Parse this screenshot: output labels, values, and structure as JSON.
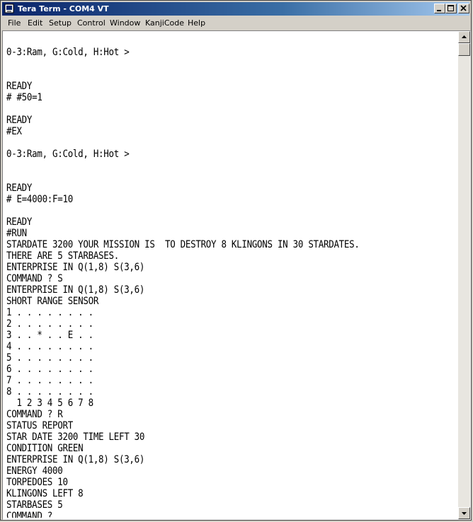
{
  "window": {
    "title": "Tera Term - COM4 VT"
  },
  "menu": [
    "File",
    "Edit",
    "Setup",
    "Control",
    "Window",
    "KanjiCode",
    "Help"
  ],
  "terminal": {
    "lines": [
      "",
      "0-3:Ram, G:Cold, H:Hot >",
      "",
      "",
      "READY",
      "# #50=1",
      "",
      "READY",
      "#EX",
      "",
      "0-3:Ram, G:Cold, H:Hot >",
      "",
      "",
      "READY",
      "# E=4000:F=10",
      "",
      "READY",
      "#RUN",
      "STARDATE 3200 YOUR MISSION IS  TO DESTROY 8 KLINGONS IN 30 STARDATES.",
      "THERE ARE 5 STARBASES.",
      "ENTERPRISE IN Q(1,8) S(3,6)",
      "COMMAND ? S",
      "ENTERPRISE IN Q(1,8) S(3,6)",
      "SHORT RANGE SENSOR",
      "1 . . . . . . . .",
      "2 . . . . . . . .",
      "3 . . * . . E . .",
      "4 . . . . . . . .",
      "5 . . . . . . . .",
      "6 . . . . . . . .",
      "7 . . . . . . . .",
      "8 . . . . . . . .",
      "  1 2 3 4 5 6 7 8",
      "COMMAND ? R",
      "STATUS REPORT",
      "STAR DATE 3200 TIME LEFT 30",
      "CONDITION GREEN",
      "ENTERPRISE IN Q(1,8) S(3,6)",
      "ENERGY 4000",
      "TORPEDOES 10",
      "KLINGONS LEFT 8",
      "STARBASES 5",
      "COMMAND ?"
    ]
  },
  "icons": {
    "app": "teraterm-app-icon",
    "minimize": "minimize-icon",
    "maximize": "maximize-icon",
    "close": "close-icon",
    "scroll_up": "scroll-up-arrow-icon",
    "scroll_down": "scroll-down-arrow-icon"
  },
  "colors": {
    "title_active": "#0a246a",
    "window_face": "#d4d0c8",
    "terminal_bg": "#ffffff",
    "terminal_fg": "#000000"
  }
}
